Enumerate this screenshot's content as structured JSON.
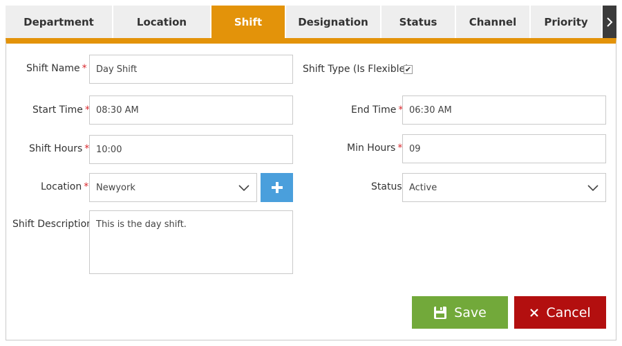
{
  "tabs": [
    {
      "label": "Department",
      "active": false
    },
    {
      "label": "Location",
      "active": false
    },
    {
      "label": "Shift",
      "active": true
    },
    {
      "label": "Designation",
      "active": false
    },
    {
      "label": "Status",
      "active": false
    },
    {
      "label": "Channel",
      "active": false
    },
    {
      "label": "Priority",
      "active": false
    }
  ],
  "tab_scroll_icon": "chevron-right-icon",
  "form": {
    "shift_name": {
      "label": "Shift Name",
      "required": "*",
      "value": "Day Shift"
    },
    "shift_type": {
      "label": "Shift Type (Is Flexible)",
      "checked": true,
      "check_glyph": "✔"
    },
    "start_time": {
      "label": "Start Time",
      "required": "*",
      "value": "08:30 AM"
    },
    "end_time": {
      "label": "End Time",
      "required": "*",
      "value": "06:30 AM"
    },
    "shift_hours": {
      "label": "Shift Hours",
      "required": "*",
      "value": "10:00"
    },
    "min_hours": {
      "label": "Min Hours",
      "required": "*",
      "value": "09"
    },
    "location": {
      "label": "Location",
      "required": "*",
      "value": "Newyork"
    },
    "status": {
      "label": "Status",
      "value": "Active"
    },
    "shift_description": {
      "label": "Shift Description",
      "value": "This is  the day shift."
    }
  },
  "buttons": {
    "save": {
      "label": "Save",
      "icon": "floppy-disk-icon"
    },
    "cancel": {
      "label": "Cancel",
      "icon": "close-icon"
    }
  },
  "colors": {
    "accent": "#e3930a",
    "required": "#d9262b",
    "add_button": "#4a9fdc",
    "save_button": "#72a93a",
    "cancel_button": "#b30f0f"
  }
}
